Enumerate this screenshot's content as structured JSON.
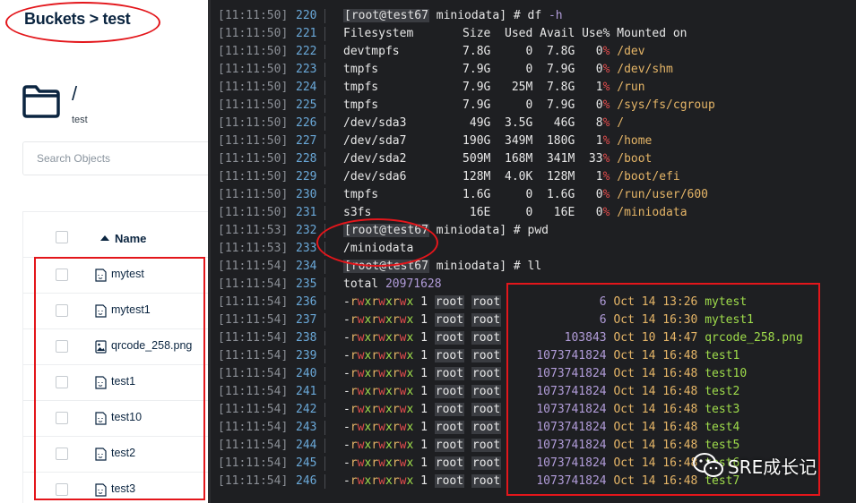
{
  "left_panel": {
    "breadcrumb": "Buckets > test",
    "path": "/",
    "bucket": "test",
    "search_placeholder": "Search Objects",
    "name_header": "Name",
    "files": [
      {
        "name": "mytest",
        "icon": "file-icon"
      },
      {
        "name": "mytest1",
        "icon": "file-icon"
      },
      {
        "name": "qrcode_258.png",
        "icon": "image-icon"
      },
      {
        "name": "test1",
        "icon": "file-icon"
      },
      {
        "name": "test10",
        "icon": "file-icon"
      },
      {
        "name": "test2",
        "icon": "file-icon"
      },
      {
        "name": "test3",
        "icon": "file-icon"
      }
    ]
  },
  "terminal": {
    "lines": [
      {
        "ts": "[11:11:50]",
        "n": "220",
        "kind": "prompt",
        "user": "root@test67",
        "dir": "miniodata",
        "cmd": "df",
        "arg": "-h"
      },
      {
        "ts": "[11:11:50]",
        "n": "221",
        "kind": "df-header",
        "fs": "Filesystem",
        "size": "Size",
        "used": "Used",
        "avail": "Avail",
        "use": "Use%",
        "mnt": "Mounted on"
      },
      {
        "ts": "[11:11:50]",
        "n": "222",
        "kind": "df",
        "fs": "devtmpfs",
        "size": "7.8G",
        "used": "0",
        "avail": "7.8G",
        "use": "0",
        "mnt": "/dev"
      },
      {
        "ts": "[11:11:50]",
        "n": "223",
        "kind": "df",
        "fs": "tmpfs",
        "size": "7.9G",
        "used": "0",
        "avail": "7.9G",
        "use": "0",
        "mnt": "/dev/shm"
      },
      {
        "ts": "[11:11:50]",
        "n": "224",
        "kind": "df",
        "fs": "tmpfs",
        "size": "7.9G",
        "used": "25M",
        "avail": "7.8G",
        "use": "1",
        "mnt": "/run"
      },
      {
        "ts": "[11:11:50]",
        "n": "225",
        "kind": "df",
        "fs": "tmpfs",
        "size": "7.9G",
        "used": "0",
        "avail": "7.9G",
        "use": "0",
        "mnt": "/sys/fs/cgroup"
      },
      {
        "ts": "[11:11:50]",
        "n": "226",
        "kind": "df",
        "fs": "/dev/sda3",
        "size": "49G",
        "used": "3.5G",
        "avail": "46G",
        "use": "8",
        "mnt": "/"
      },
      {
        "ts": "[11:11:50]",
        "n": "227",
        "kind": "df",
        "fs": "/dev/sda7",
        "size": "190G",
        "used": "349M",
        "avail": "180G",
        "use": "1",
        "mnt": "/home"
      },
      {
        "ts": "[11:11:50]",
        "n": "228",
        "kind": "df",
        "fs": "/dev/sda2",
        "size": "509M",
        "used": "168M",
        "avail": "341M",
        "use": "33",
        "mnt": "/boot"
      },
      {
        "ts": "[11:11:50]",
        "n": "229",
        "kind": "df",
        "fs": "/dev/sda6",
        "size": "128M",
        "used": "4.0K",
        "avail": "128M",
        "use": "1",
        "mnt": "/boot/efi"
      },
      {
        "ts": "[11:11:50]",
        "n": "230",
        "kind": "df",
        "fs": "tmpfs",
        "size": "1.6G",
        "used": "0",
        "avail": "1.6G",
        "use": "0",
        "mnt": "/run/user/600"
      },
      {
        "ts": "[11:11:50]",
        "n": "231",
        "kind": "df",
        "fs": "s3fs",
        "size": "16E",
        "used": "0",
        "avail": "16E",
        "use": "0",
        "mnt": "/miniodata"
      },
      {
        "ts": "[11:11:53]",
        "n": "232",
        "kind": "prompt",
        "user": "root@test67",
        "dir": "miniodata",
        "cmd": "pwd",
        "arg": ""
      },
      {
        "ts": "[11:11:53]",
        "n": "233",
        "kind": "text",
        "text": "/miniodata"
      },
      {
        "ts": "[11:11:54]",
        "n": "234",
        "kind": "prompt",
        "user": "root@test67",
        "dir": "miniodata",
        "cmd": "ll",
        "arg": ""
      },
      {
        "ts": "[11:11:54]",
        "n": "235",
        "kind": "total",
        "label": "total",
        "value": "20971628"
      },
      {
        "ts": "[11:11:54]",
        "n": "236",
        "kind": "ls",
        "perm": "-rwxrwxrwx",
        "links": "1",
        "owner": "root",
        "group": "root",
        "size": "6",
        "month": "Oct",
        "day": "14",
        "time": "13:26",
        "name": "mytest"
      },
      {
        "ts": "[11:11:54]",
        "n": "237",
        "kind": "ls",
        "perm": "-rwxrwxrwx",
        "links": "1",
        "owner": "root",
        "group": "root",
        "size": "6",
        "month": "Oct",
        "day": "14",
        "time": "16:30",
        "name": "mytest1"
      },
      {
        "ts": "[11:11:54]",
        "n": "238",
        "kind": "ls",
        "perm": "-rwxrwxrwx",
        "links": "1",
        "owner": "root",
        "group": "root",
        "size": "103843",
        "month": "Oct",
        "day": "10",
        "time": "14:47",
        "name": "qrcode_258.png"
      },
      {
        "ts": "[11:11:54]",
        "n": "239",
        "kind": "ls",
        "perm": "-rwxrwxrwx",
        "links": "1",
        "owner": "root",
        "group": "root",
        "size": "1073741824",
        "month": "Oct",
        "day": "14",
        "time": "16:48",
        "name": "test1"
      },
      {
        "ts": "[11:11:54]",
        "n": "240",
        "kind": "ls",
        "perm": "-rwxrwxrwx",
        "links": "1",
        "owner": "root",
        "group": "root",
        "size": "1073741824",
        "month": "Oct",
        "day": "14",
        "time": "16:48",
        "name": "test10"
      },
      {
        "ts": "[11:11:54]",
        "n": "241",
        "kind": "ls",
        "perm": "-rwxrwxrwx",
        "links": "1",
        "owner": "root",
        "group": "root",
        "size": "1073741824",
        "month": "Oct",
        "day": "14",
        "time": "16:48",
        "name": "test2"
      },
      {
        "ts": "[11:11:54]",
        "n": "242",
        "kind": "ls",
        "perm": "-rwxrwxrwx",
        "links": "1",
        "owner": "root",
        "group": "root",
        "size": "1073741824",
        "month": "Oct",
        "day": "14",
        "time": "16:48",
        "name": "test3"
      },
      {
        "ts": "[11:11:54]",
        "n": "243",
        "kind": "ls",
        "perm": "-rwxrwxrwx",
        "links": "1",
        "owner": "root",
        "group": "root",
        "size": "1073741824",
        "month": "Oct",
        "day": "14",
        "time": "16:48",
        "name": "test4"
      },
      {
        "ts": "[11:11:54]",
        "n": "244",
        "kind": "ls",
        "perm": "-rwxrwxrwx",
        "links": "1",
        "owner": "root",
        "group": "root",
        "size": "1073741824",
        "month": "Oct",
        "day": "14",
        "time": "16:48",
        "name": "test5"
      },
      {
        "ts": "[11:11:54]",
        "n": "245",
        "kind": "ls",
        "perm": "-rwxrwxrwx",
        "links": "1",
        "owner": "root",
        "group": "root",
        "size": "1073741824",
        "month": "Oct",
        "day": "14",
        "time": "16:48",
        "name": "test6"
      },
      {
        "ts": "[11:11:54]",
        "n": "246",
        "kind": "ls",
        "perm": "-rwxrwxrwx",
        "links": "1",
        "owner": "root",
        "group": "root",
        "size": "1073741824",
        "month": "Oct",
        "day": "14",
        "time": "16:48",
        "name": "test7"
      }
    ]
  },
  "watermark": "SRE成长记",
  "colors": {
    "highlight_red": "#e3161b",
    "terminal_bg": "#1e1f22",
    "file_name_green": "#9fdc4b",
    "size_purple": "#b19cd9",
    "date_yellow": "#e5b567"
  }
}
